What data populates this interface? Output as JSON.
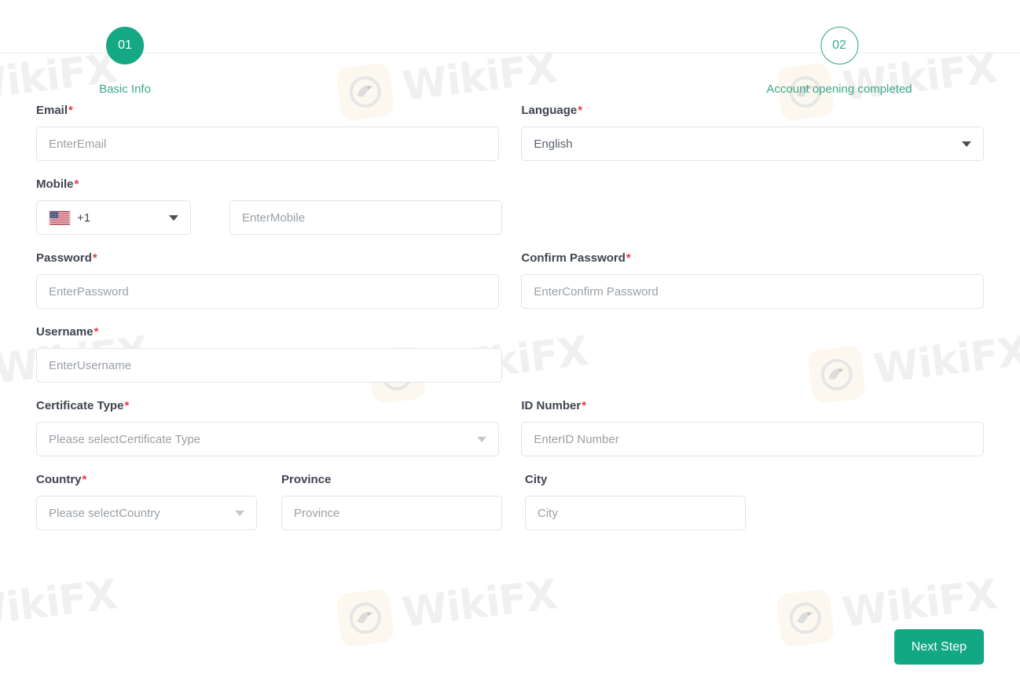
{
  "theme": {
    "accent": "#13a884",
    "accent_text": "#3aa98c",
    "required_mark": "#e63946",
    "label_text": "#3f4450",
    "placeholder_text": "#9aa0a6",
    "border": "#e2e4e8",
    "watermark_text_color": "#e3e3e3",
    "watermark_logo_bg": "#faf3e0"
  },
  "stepper": {
    "steps": [
      {
        "number": "01",
        "label": "Basic Info",
        "state": "active"
      },
      {
        "number": "02",
        "label": "Account opening completed",
        "state": "inactive"
      }
    ]
  },
  "form": {
    "email": {
      "label": "Email",
      "required": "*",
      "placeholder": "EnterEmail",
      "value": ""
    },
    "language": {
      "label": "Language",
      "required": "*",
      "value": "English",
      "options": [
        "English"
      ]
    },
    "mobile": {
      "label": "Mobile",
      "required": "*",
      "dial_code": "+1",
      "flag": "us-flag-icon",
      "placeholder": "EnterMobile",
      "value": ""
    },
    "password": {
      "label": "Password",
      "required": "*",
      "placeholder": "EnterPassword",
      "value": ""
    },
    "confirm_password": {
      "label": "Confirm Password",
      "required": "*",
      "placeholder": "EnterConfirm Password",
      "value": ""
    },
    "username": {
      "label": "Username",
      "required": "*",
      "placeholder": "EnterUsername",
      "value": ""
    },
    "certificate_type": {
      "label": "Certificate Type",
      "required": "*",
      "placeholder": "Please selectCertificate Type",
      "value": ""
    },
    "id_number": {
      "label": "ID Number",
      "required": "*",
      "placeholder": "EnterID Number",
      "value": ""
    },
    "country": {
      "label": "Country",
      "required": "*",
      "placeholder": "Please selectCountry",
      "value": ""
    },
    "province": {
      "label": "Province",
      "required": "",
      "placeholder": "Province",
      "value": ""
    },
    "city": {
      "label": "City",
      "required": "",
      "placeholder": "City",
      "value": ""
    }
  },
  "footer": {
    "next_step_label": "Next Step"
  },
  "watermark": {
    "text": "WikiFX",
    "logo_name": "wikifx-eagle-logo"
  }
}
